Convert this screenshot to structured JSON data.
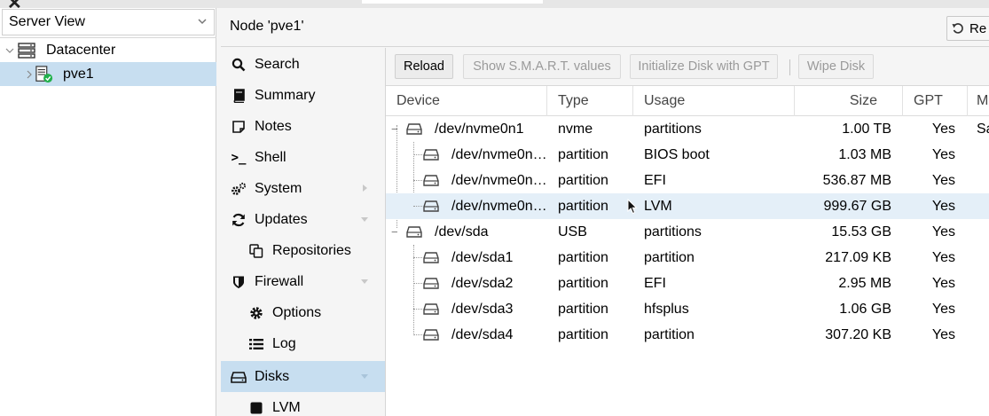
{
  "server_view": {
    "label": "Server View"
  },
  "tree": {
    "items": [
      {
        "label": "Datacenter"
      },
      {
        "label": "pve1"
      }
    ]
  },
  "node_header": {
    "title": "Node 'pve1'",
    "reload_partial_label": "Re"
  },
  "nav": {
    "items": [
      {
        "label": "Search",
        "icon": "search-icon"
      },
      {
        "label": "Summary",
        "icon": "book-icon"
      },
      {
        "label": "Notes",
        "icon": "notes-icon"
      },
      {
        "label": "Shell",
        "icon": "terminal-icon"
      },
      {
        "label": "System",
        "icon": "gears-icon"
      },
      {
        "label": "Updates",
        "icon": "refresh-icon"
      },
      {
        "label": "Repositories",
        "icon": "copy-icon"
      },
      {
        "label": "Firewall",
        "icon": "shield-icon"
      },
      {
        "label": "Options",
        "icon": "gear-icon"
      },
      {
        "label": "Log",
        "icon": "list-icon"
      },
      {
        "label": "Disks",
        "icon": "hdd-icon"
      },
      {
        "label": "LVM",
        "icon": "square-icon"
      }
    ]
  },
  "toolbar": {
    "reload": "Reload",
    "smart": "Show S.M.A.R.T. values",
    "init_gpt": "Initialize Disk with GPT",
    "wipe": "Wipe Disk"
  },
  "grid": {
    "columns": [
      "Device",
      "Type",
      "Usage",
      "Size",
      "GPT",
      "M"
    ],
    "rows": [
      {
        "device": "/dev/nvme0n1",
        "type": "nvme",
        "usage": "partitions",
        "size": "1.00 TB",
        "gpt": "Yes",
        "model": "Sa"
      },
      {
        "device": "/dev/nvme0n…",
        "type": "partition",
        "usage": "BIOS boot",
        "size": "1.03 MB",
        "gpt": "Yes",
        "model": ""
      },
      {
        "device": "/dev/nvme0n…",
        "type": "partition",
        "usage": "EFI",
        "size": "536.87 MB",
        "gpt": "Yes",
        "model": ""
      },
      {
        "device": "/dev/nvme0n…",
        "type": "partition",
        "usage": "LVM",
        "size": "999.67 GB",
        "gpt": "Yes",
        "model": ""
      },
      {
        "device": "/dev/sda",
        "type": "USB",
        "usage": "partitions",
        "size": "15.53 GB",
        "gpt": "Yes",
        "model": ""
      },
      {
        "device": "/dev/sda1",
        "type": "partition",
        "usage": "partition",
        "size": "217.09 KB",
        "gpt": "Yes",
        "model": ""
      },
      {
        "device": "/dev/sda2",
        "type": "partition",
        "usage": "EFI",
        "size": "2.95 MB",
        "gpt": "Yes",
        "model": ""
      },
      {
        "device": "/dev/sda3",
        "type": "partition",
        "usage": "hfsplus",
        "size": "1.06 GB",
        "gpt": "Yes",
        "model": ""
      },
      {
        "device": "/dev/sda4",
        "type": "partition",
        "usage": "partition",
        "size": "307.20 KB",
        "gpt": "Yes",
        "model": ""
      }
    ]
  },
  "colors": {
    "selection": "#c7def0",
    "row_selection": "#e4eff8",
    "ok_badge": "#21b04b"
  }
}
